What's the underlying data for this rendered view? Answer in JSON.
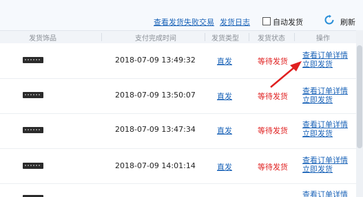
{
  "toolbar": {
    "failed_link": "查看发货失败交易",
    "log_link": "发货日志",
    "auto_ship_label": "自动发货",
    "auto_ship_checked": false,
    "refresh_label": "刷新"
  },
  "table": {
    "headers": [
      "发货饰品",
      "支付完成时间",
      "发货类型",
      "发货状态",
      "操作"
    ],
    "rows": [
      {
        "time": "2018-07-09 13:49:32",
        "type": "直发",
        "status": "等待发货",
        "view": "查看订单详情",
        "ship": "立即发货"
      },
      {
        "time": "2018-07-09 13:50:07",
        "type": "直发",
        "status": "等待发货",
        "view": "查看订单详情",
        "ship": "立即发货"
      },
      {
        "time": "2018-07-09 13:47:34",
        "type": "直发",
        "status": "等待发货",
        "view": "查看订单详情",
        "ship": "立即发货"
      },
      {
        "time": "2018-07-09 14:01:14",
        "type": "直发",
        "status": "等待发货",
        "view": "查看订单详情",
        "ship": "立即发货"
      },
      {
        "time": "",
        "type": "",
        "status": "",
        "view": "查看订单详情",
        "ship": ""
      }
    ]
  },
  "colors": {
    "link": "#1a63b8",
    "status_red": "#e02020",
    "annotation_arrow": "#e02020"
  }
}
